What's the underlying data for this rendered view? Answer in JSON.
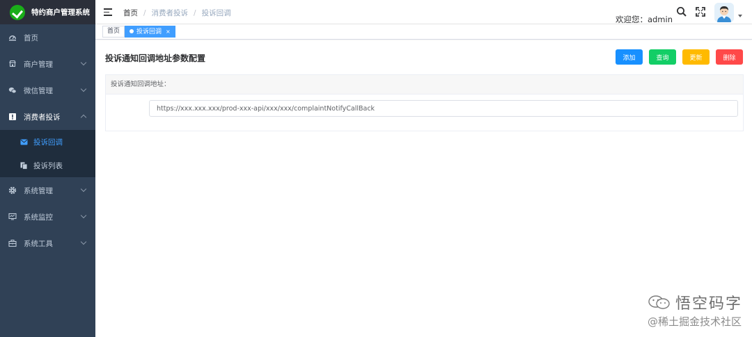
{
  "app": {
    "title": "特约商户管理系统",
    "brand_color": "#1aad19",
    "sidebar_bg": "#304156",
    "accent": "#409eff"
  },
  "sidebar": {
    "items": [
      {
        "label": "首页",
        "icon": "dashboard-icon"
      },
      {
        "label": "商户管理",
        "icon": "store-icon",
        "has_children": true
      },
      {
        "label": "微信管理",
        "icon": "wechat-icon",
        "has_children": true
      },
      {
        "label": "消费者投诉",
        "icon": "complaint-icon",
        "has_children": true,
        "expanded": true,
        "children": [
          {
            "label": "投诉回调",
            "icon": "message-icon",
            "active": true
          },
          {
            "label": "投诉列表",
            "icon": "document-icon"
          }
        ]
      },
      {
        "label": "系统管理",
        "icon": "gear-icon",
        "has_children": true
      },
      {
        "label": "系统监控",
        "icon": "monitor-icon",
        "has_children": true
      },
      {
        "label": "系统工具",
        "icon": "toolbox-icon",
        "has_children": true
      }
    ]
  },
  "header": {
    "breadcrumb": [
      "首页",
      "消费者投诉",
      "投诉回调"
    ],
    "welcome": "欢迎您：admin",
    "icons": [
      "search-icon",
      "fullscreen-icon",
      "avatar",
      "caret-down-icon"
    ]
  },
  "tags": [
    {
      "label": "首页",
      "active": false
    },
    {
      "label": "投诉回调",
      "active": true,
      "close": "×"
    }
  ],
  "main": {
    "title": "投诉通知回调地址参数配置",
    "buttons": [
      {
        "label": "添加",
        "color": "#1890ff"
      },
      {
        "label": "查询",
        "color": "#13ce66"
      },
      {
        "label": "更新",
        "color": "#ffba00"
      },
      {
        "label": "删除",
        "color": "#ff4949"
      }
    ],
    "card": {
      "header": "投诉通知回调地址：",
      "url_value": "https://xxx.xxx.xxx/prod-xxx-api/xxx/xxx/complaintNotifyCallBack"
    }
  },
  "watermark": {
    "line1": "悟空码字",
    "line2": "@稀土掘金技术社区"
  }
}
